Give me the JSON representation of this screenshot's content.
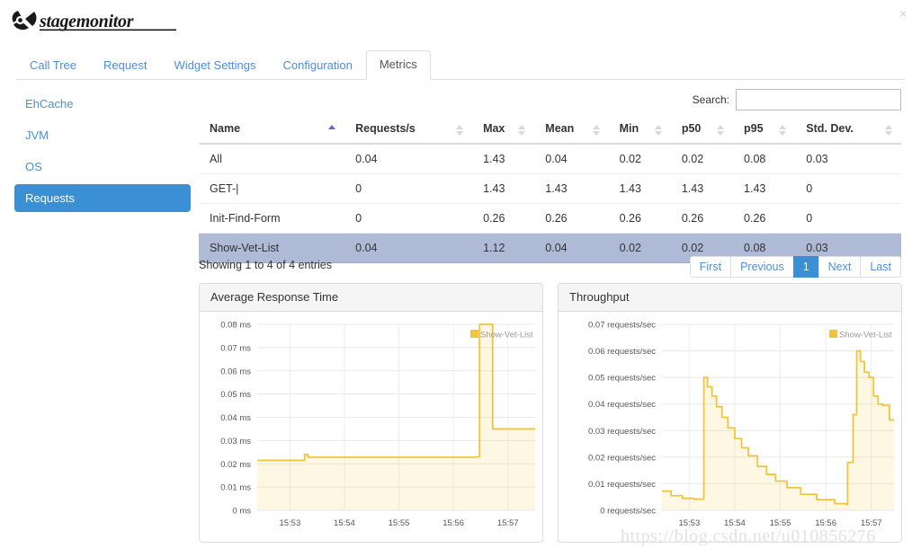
{
  "app": {
    "logo_text": "stagemonitor",
    "close_label": "×"
  },
  "tabs": [
    {
      "label": "Call Tree",
      "active": false
    },
    {
      "label": "Request",
      "active": false
    },
    {
      "label": "Widget Settings",
      "active": false
    },
    {
      "label": "Configuration",
      "active": false
    },
    {
      "label": "Metrics",
      "active": true
    }
  ],
  "sidebar": {
    "items": [
      {
        "label": "EhCache",
        "active": false
      },
      {
        "label": "JVM",
        "active": false
      },
      {
        "label": "OS",
        "active": false
      },
      {
        "label": "Requests",
        "active": true
      }
    ]
  },
  "search": {
    "label": "Search:",
    "value": "",
    "placeholder": ""
  },
  "table": {
    "columns": [
      {
        "label": "Name",
        "sort": "asc"
      },
      {
        "label": "Requests/s",
        "sort": "none"
      },
      {
        "label": "Max",
        "sort": "none"
      },
      {
        "label": "Mean",
        "sort": "none"
      },
      {
        "label": "Min",
        "sort": "none"
      },
      {
        "label": "p50",
        "sort": "none"
      },
      {
        "label": "p95",
        "sort": "none"
      },
      {
        "label": "Std. Dev.",
        "sort": "none"
      }
    ],
    "rows": [
      {
        "selected": false,
        "cells": [
          "All",
          "0.04",
          "1.43",
          "0.04",
          "0.02",
          "0.02",
          "0.08",
          "0.03"
        ]
      },
      {
        "selected": false,
        "cells": [
          "GET-|",
          "0",
          "1.43",
          "1.43",
          "1.43",
          "1.43",
          "1.43",
          "0"
        ]
      },
      {
        "selected": false,
        "cells": [
          "Init-Find-Form",
          "0",
          "0.26",
          "0.26",
          "0.26",
          "0.26",
          "0.26",
          "0"
        ]
      },
      {
        "selected": true,
        "cells": [
          "Show-Vet-List",
          "0.04",
          "1.12",
          "0.04",
          "0.02",
          "0.02",
          "0.08",
          "0.03"
        ]
      }
    ],
    "showing_info": "Showing 1 to 4 of 4 entries"
  },
  "pagination": {
    "buttons": [
      {
        "label": "First",
        "active": false
      },
      {
        "label": "Previous",
        "active": false
      },
      {
        "label": "1",
        "active": true
      },
      {
        "label": "Next",
        "active": false
      },
      {
        "label": "Last",
        "active": false
      }
    ]
  },
  "colors": {
    "accent_blue": "#3b8fd4",
    "link_blue": "#4a90d9",
    "selected_row": "#aebad6",
    "series_yellow": "#f0c53c",
    "series_fill": "#fdf6df"
  },
  "watermark": "https://blog.csdn.net/u010856276",
  "chart_data": [
    {
      "type": "area",
      "title": "Average Response Time",
      "xlabel": "",
      "ylabel": "ms",
      "legend": [
        {
          "name": "Show-Vet-List",
          "color": "#f0c53c"
        }
      ],
      "legend_position": "top-right",
      "grid": true,
      "ylim": [
        0,
        0.08
      ],
      "ytick_labels": [
        "0.08 ms",
        "0.07 ms",
        "0.06 ms",
        "0.05 ms",
        "0.04 ms",
        "0.03 ms",
        "0.02 ms",
        "0.01 ms",
        "0 ms"
      ],
      "ytick_values": [
        0.08,
        0.07,
        0.06,
        0.05,
        0.04,
        0.03,
        0.02,
        0.01,
        0
      ],
      "xtick_labels": [
        "15:53",
        "15:54",
        "15:55",
        "15:56",
        "15:57"
      ],
      "xtick_values": [
        15.53,
        15.54,
        15.55,
        15.56,
        15.57
      ],
      "xlim": [
        15.524,
        15.575
      ],
      "series": [
        {
          "name": "Show-Vet-List",
          "color": "#f0c53c",
          "x": [
            15.524,
            15.532,
            15.5327,
            15.5333,
            15.534,
            15.535,
            15.54,
            15.545,
            15.55,
            15.555,
            15.564,
            15.5648,
            15.5652,
            15.566,
            15.5668,
            15.5672,
            15.568,
            15.575
          ],
          "y": [
            0.0215,
            0.0215,
            0.024,
            0.0228,
            0.0228,
            0.0228,
            0.0228,
            0.0228,
            0.0228,
            0.0228,
            0.023,
            0.08,
            0.08,
            0.08,
            0.08,
            0.035,
            0.035,
            0.035
          ]
        }
      ]
    },
    {
      "type": "area",
      "title": "Throughput",
      "xlabel": "",
      "ylabel": "requests/sec",
      "legend": [
        {
          "name": "Show-Vet-List",
          "color": "#f0c53c"
        }
      ],
      "legend_position": "top-right",
      "grid": true,
      "ylim": [
        0,
        0.07
      ],
      "ytick_labels": [
        "0.07 requests/sec",
        "0.06 requests/sec",
        "0.05 requests/sec",
        "0.04 requests/sec",
        "0.03 requests/sec",
        "0.02 requests/sec",
        "0.01 requests/sec",
        "0 requests/sec"
      ],
      "ytick_values": [
        0.07,
        0.06,
        0.05,
        0.04,
        0.03,
        0.02,
        0.01,
        0
      ],
      "xtick_labels": [
        "15:53",
        "15:54",
        "15:55",
        "15:56",
        "15:57"
      ],
      "xtick_values": [
        15.53,
        15.54,
        15.55,
        15.56,
        15.57
      ],
      "xlim": [
        15.524,
        15.575
      ],
      "series": [
        {
          "name": "Show-Vet-List",
          "color": "#f0c53c",
          "x": [
            15.524,
            15.526,
            15.5285,
            15.531,
            15.533,
            15.5332,
            15.534,
            15.535,
            15.536,
            15.5372,
            15.5385,
            15.54,
            15.5415,
            15.543,
            15.545,
            15.547,
            15.549,
            15.5515,
            15.5545,
            15.558,
            15.562,
            15.5645,
            15.5648,
            15.566,
            15.5668,
            15.5676,
            15.5685,
            15.5695,
            15.5705,
            15.5715,
            15.5725,
            15.574,
            15.575
          ],
          "y": [
            0.0072,
            0.0055,
            0.0045,
            0.0042,
            0.0042,
            0.05,
            0.0465,
            0.043,
            0.039,
            0.035,
            0.031,
            0.027,
            0.0235,
            0.0205,
            0.0165,
            0.0135,
            0.011,
            0.0085,
            0.006,
            0.004,
            0.0025,
            0.0022,
            0.018,
            0.036,
            0.06,
            0.056,
            0.052,
            0.05,
            0.043,
            0.04,
            0.0395,
            0.034,
            0.034
          ]
        }
      ]
    }
  ]
}
